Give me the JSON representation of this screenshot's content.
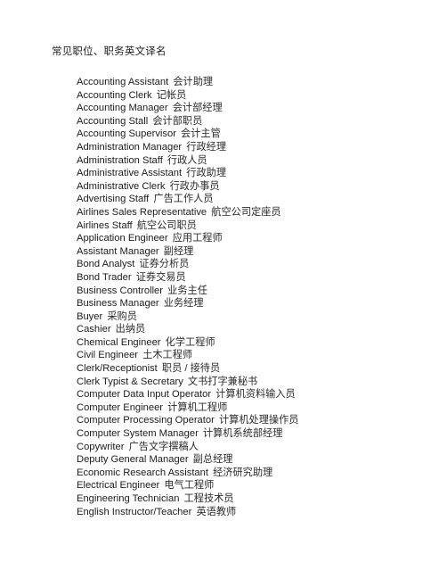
{
  "document": {
    "title": "常见职位、职务英文译名",
    "background_color": "#ffffff",
    "text_color": "#222222"
  },
  "glossary": {
    "entries": [
      {
        "en": "Accounting Assistant",
        "zh": "会计助理"
      },
      {
        "en": "Accounting Clerk",
        "zh": "记帐员"
      },
      {
        "en": "Accounting Manager",
        "zh": "会计部经理"
      },
      {
        "en": "Accounting Stall",
        "zh": "会计部职员"
      },
      {
        "en": "Accounting Supervisor",
        "zh": "会计主管"
      },
      {
        "en": "Administration Manager",
        "zh": "行政经理"
      },
      {
        "en": "Administration Staff",
        "zh": "行政人员"
      },
      {
        "en": "Administrative Assistant",
        "zh": "行政助理"
      },
      {
        "en": "Administrative Clerk",
        "zh": "行政办事员"
      },
      {
        "en": "Advertising Staff",
        "zh": "广告工作人员"
      },
      {
        "en": "Airlines Sales Representative",
        "zh": "航空公司定座员"
      },
      {
        "en": "Airlines Staff",
        "zh": "航空公司职员"
      },
      {
        "en": "Application Engineer",
        "zh": "应用工程师"
      },
      {
        "en": "Assistant Manager",
        "zh": "副经理"
      },
      {
        "en": "Bond Analyst",
        "zh": "证券分析员"
      },
      {
        "en": "Bond Trader",
        "zh": "证券交易员"
      },
      {
        "en": "Business Controller",
        "zh": "业务主任"
      },
      {
        "en": "Business Manager",
        "zh": "业务经理"
      },
      {
        "en": "Buyer",
        "zh": "采购员"
      },
      {
        "en": "Cashier",
        "zh": "出纳员"
      },
      {
        "en": "Chemical Engineer",
        "zh": "化学工程师"
      },
      {
        "en": "Civil Engineer",
        "zh": "土木工程师"
      },
      {
        "en": "Clerk/Receptionist",
        "zh": "职员 / 接待员"
      },
      {
        "en": "Clerk Typist & Secretary",
        "zh": "文书打字兼秘书"
      },
      {
        "en": "Computer Data Input Operator",
        "zh": "计算机资料输入员"
      },
      {
        "en": "Computer Engineer",
        "zh": "计算机工程师"
      },
      {
        "en": "Computer Processing Operator",
        "zh": "计算机处理操作员"
      },
      {
        "en": "Computer System Manager",
        "zh": "计算机系统部经理"
      },
      {
        "en": "Copywriter",
        "zh": "广告文字撰稿人"
      },
      {
        "en": "Deputy General Manager",
        "zh": "副总经理"
      },
      {
        "en": "Economic Research Assistant",
        "zh": "经济研究助理"
      },
      {
        "en": "Electrical Engineer",
        "zh": "电气工程师"
      },
      {
        "en": "Engineering Technician",
        "zh": "工程技术员"
      },
      {
        "en": "English Instructor/Teacher",
        "zh": "英语教师"
      }
    ]
  }
}
